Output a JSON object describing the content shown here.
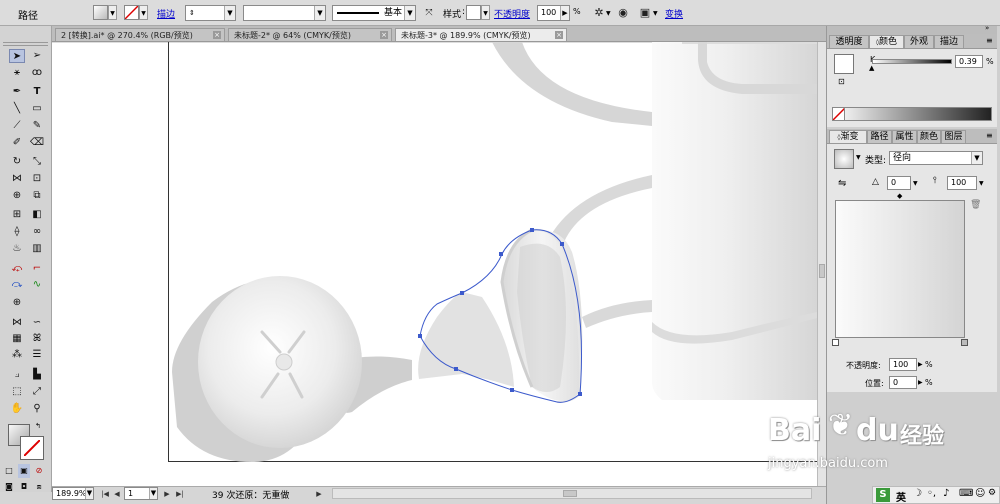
{
  "control_bar": {
    "object_type": "路径",
    "stroke_link": "描边",
    "stroke_weight": "",
    "stroke_profile_label": "基本",
    "style_label": "样式",
    "opacity_link": "不透明度",
    "opacity_value": "100",
    "opacity_unit": "%",
    "transform_link": "变换"
  },
  "doc_tabs": [
    {
      "label": "2 [转换].ai* @ 270.4% (RGB/预览)",
      "close": "×"
    },
    {
      "label": "未标题-2* @ 64% (CMYK/预览)",
      "close": "×"
    },
    {
      "label": "未标题-3* @ 189.9% (CMYK/预览)",
      "close": "×"
    }
  ],
  "status_bar": {
    "zoom": "189.9%",
    "page": "1",
    "status_text": "39 次还原：无重做",
    "first": "|◀",
    "prev": "◀",
    "next": "▶",
    "last": "▶|",
    "status_arrow": "▶"
  },
  "color_panel": {
    "tabs": [
      "透明度",
      "颜色",
      "外观",
      "描边"
    ],
    "channel_label": "K",
    "k_value": "0.39",
    "k_unit": "%"
  },
  "gradient_panel": {
    "tabs": [
      "渐变",
      "路径",
      "属性",
      "颜色",
      "图层"
    ],
    "type_label": "类型:",
    "type_value": "径向",
    "angle_value": "0",
    "ratio_value": "100",
    "opacity_label": "不透明度:",
    "opacity_value": "100",
    "position_label": "位置:",
    "position_value": "0",
    "pct": "%"
  },
  "watermark": {
    "brand": "Bai",
    "brand2": "du",
    "jingyan": "经验",
    "url": "jingyan.baidu.com"
  },
  "ime_bar": {
    "label": "英"
  },
  "colors": {
    "selection": "#3c5acc",
    "link": "#0000cc"
  }
}
